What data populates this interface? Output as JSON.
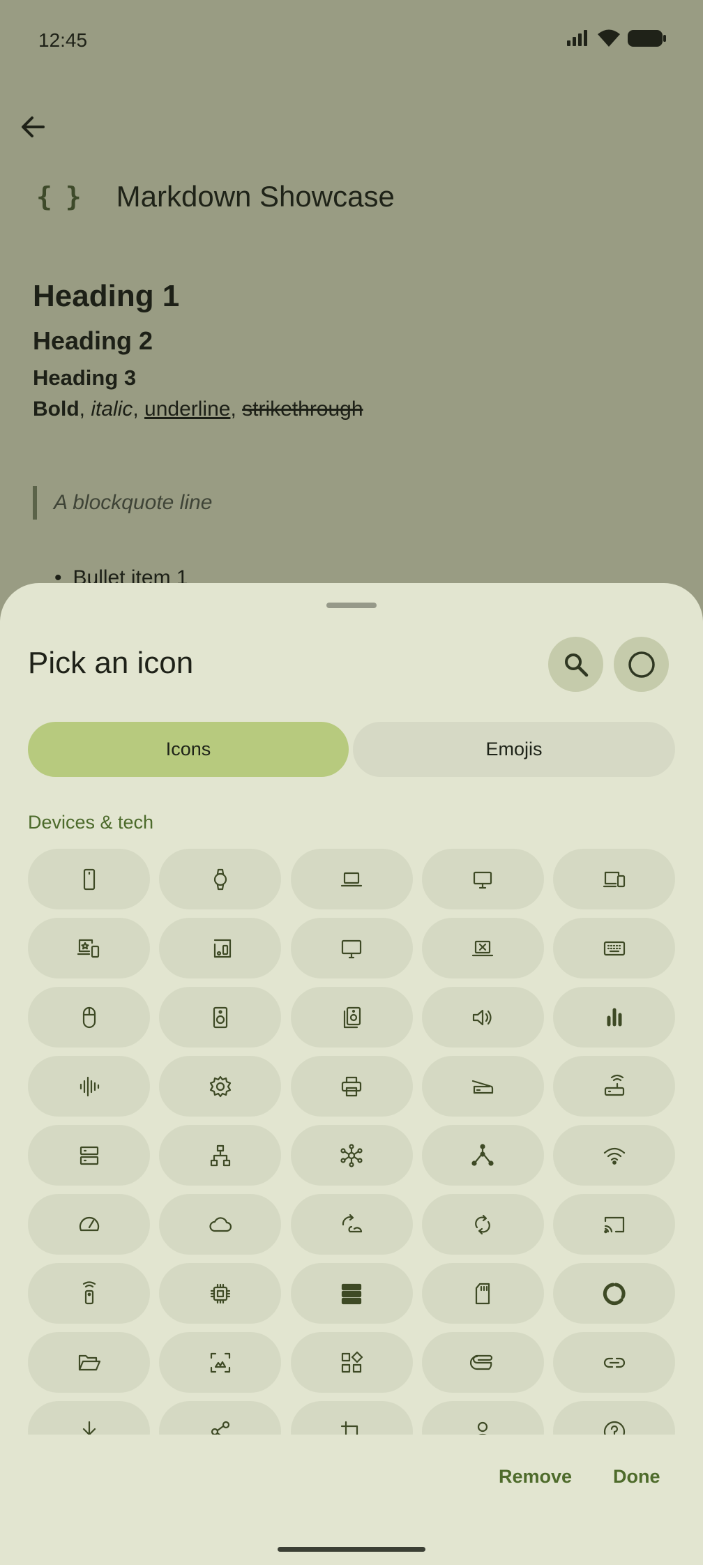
{
  "status_bar": {
    "time": "12:45"
  },
  "page": {
    "title": "Markdown Showcase",
    "title_icon": "code-braces-icon",
    "title_icon_glyph": "{ }"
  },
  "markdown": {
    "heading1": "Heading 1",
    "heading2": "Heading 2",
    "heading3": "Heading 3",
    "bold": "Bold",
    "italic": "italic",
    "underline": "underline",
    "strikethrough": "strikethrough",
    "sep1": ", ",
    "sep2": ", ",
    "sep3": ", ",
    "blockquote": "A blockquote line",
    "bullet1": "Bullet item 1"
  },
  "sheet": {
    "title": "Pick an icon",
    "tabs": [
      {
        "label": "Icons",
        "selected": true
      },
      {
        "label": "Emojis",
        "selected": false
      }
    ],
    "section": "Devices & tech",
    "remove_label": "Remove",
    "done_label": "Done",
    "icons": [
      "smartphone",
      "watch",
      "laptop",
      "desktop",
      "devices",
      "devices-star",
      "speaker-group",
      "tv",
      "laptop-cancel",
      "keyboard",
      "mouse",
      "speaker",
      "speaker-multi",
      "volume",
      "equalizer",
      "graphic-eq",
      "settings",
      "print",
      "scanner",
      "router",
      "storage",
      "lan",
      "hub",
      "device-hub",
      "wifi",
      "speed",
      "cloud",
      "cloud-sync",
      "sync",
      "cast",
      "remote",
      "memory",
      "dns",
      "sd-card",
      "data-usage",
      "folder-open",
      "screenshot",
      "widgets",
      "attach-file",
      "link",
      "download",
      "share",
      "crop",
      "person",
      "help"
    ]
  },
  "colors": {
    "scrim_background": "#999c83",
    "sheet_background": "#e2e5d0",
    "selected_tab": "#b7ca7e",
    "accent_text": "#4e6b2b"
  }
}
